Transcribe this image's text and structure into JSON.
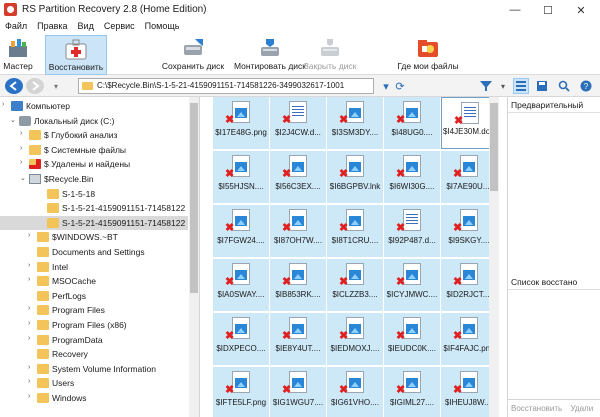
{
  "window": {
    "title": "RS Partition Recovery 2.8 (Home Edition)",
    "min": "—",
    "max": "☐",
    "close": "✕"
  },
  "menu": [
    "Файл",
    "Правка",
    "Вид",
    "Сервис",
    "Помощь"
  ],
  "ribbon": {
    "wizard": "Мастер",
    "restore": "Восстановить",
    "save_disk": "Сохранить диск",
    "mount_disk": "Монтировать диск",
    "close_disk": "Закрыть диск",
    "where_files": "Где мои файлы"
  },
  "address": {
    "path": "C:\\$Recycle.Bin\\S-1-5-21-4159091151-714581226-3499032617-1001"
  },
  "tree": [
    {
      "label": "Компьютер",
      "exp": "›",
      "icon": "computer"
    },
    {
      "label": "Локальный диск (C:)",
      "exp": "⌄",
      "icon": "drive"
    },
    {
      "label": "$ Глубокий анализ",
      "exp": "›",
      "icon": "folder"
    },
    {
      "label": "$ Системные файлы",
      "exp": "›",
      "icon": "folder"
    },
    {
      "label": "$ Удалены и найдены",
      "exp": "›",
      "icon": "folder-deleted"
    },
    {
      "label": "$Recycle.Bin",
      "exp": "⌄",
      "icon": "recycle"
    },
    {
      "label": "S-1-5-18",
      "exp": "",
      "icon": "folder"
    },
    {
      "label": "S-1-5-21-4159091151-71458122",
      "exp": "",
      "icon": "folder"
    },
    {
      "label": "S-1-5-21-4159091151-71458122",
      "exp": "",
      "icon": "folder"
    },
    {
      "label": "$WINDOWS.~BT",
      "exp": "›",
      "icon": "folder"
    },
    {
      "label": "Documents and Settings",
      "exp": "",
      "icon": "folder"
    },
    {
      "label": "Intel",
      "exp": "›",
      "icon": "folder"
    },
    {
      "label": "MSOCache",
      "exp": "›",
      "icon": "folder"
    },
    {
      "label": "PerfLogs",
      "exp": "",
      "icon": "folder"
    },
    {
      "label": "Program Files",
      "exp": "›",
      "icon": "folder"
    },
    {
      "label": "Program Files (x86)",
      "exp": "›",
      "icon": "folder"
    },
    {
      "label": "ProgramData",
      "exp": "›",
      "icon": "folder"
    },
    {
      "label": "Recovery",
      "exp": "",
      "icon": "folder"
    },
    {
      "label": "System Volume Information",
      "exp": "›",
      "icon": "folder"
    },
    {
      "label": "Users",
      "exp": "›",
      "icon": "folder"
    },
    {
      "label": "Windows",
      "exp": "›",
      "icon": "folder"
    }
  ],
  "files": [
    "$I17E48G.png",
    "$I2J4CW.d...",
    "$I3SM3DY....",
    "$I48UG0....",
    "$I4JE30M.docx",
    "$I55HJSN....",
    "$I56C3EX....",
    "$I6BGPBV.lnk",
    "$I6WI30G....",
    "$I7AE90U....",
    "$I7FGW24....",
    "$I87OH7W....",
    "$I8T1CRU....",
    "$I92P487.d...",
    "$I9SKGY....",
    "$IA0SWAY....",
    "$IB853RK....",
    "$ICLZZB3....",
    "$ICYJMWC....",
    "$ID2RJCT....",
    "$IDXPECO....",
    "$IE8Y4UT....",
    "$IEDMOXJ....",
    "$IEUDC0K....",
    "$IF4FAJC.png",
    "$IFTE5LF.png",
    "$IG1WGU7....",
    "$IG61VHO....",
    "$IGIML27....",
    "$IHEUJ8W...."
  ],
  "preview_pane": {
    "title": "Предварительный",
    "list_title": "Список восстано",
    "restore_btn": "Восстановить",
    "delete_btn": "Удали"
  }
}
